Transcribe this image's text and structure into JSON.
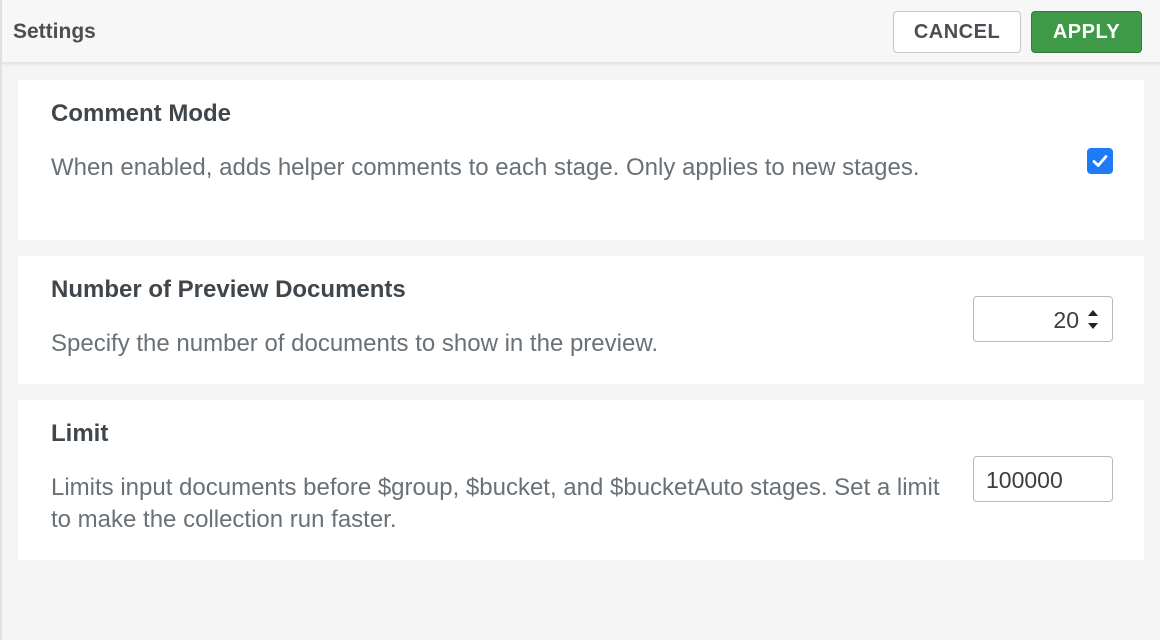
{
  "header": {
    "title": "Settings",
    "cancel_label": "CANCEL",
    "apply_label": "APPLY"
  },
  "settings": [
    {
      "title": "Comment Mode",
      "description": "When enabled, adds helper comments to each stage. Only applies to new stages.",
      "control": "checkbox",
      "checked": true
    },
    {
      "title": "Number of Preview Documents",
      "description": "Specify the number of documents to show in the preview.",
      "control": "number-stepper",
      "value": "20"
    },
    {
      "title": "Limit",
      "description": "Limits input documents before $group, $bucket, and $bucketAuto stages. Set a limit to make the collection run faster.",
      "control": "text-input",
      "value": "100000"
    }
  ],
  "icons": {
    "checkbox": "checkmark-icon",
    "stepper": "up-down-arrows-icon"
  },
  "colors": {
    "accent_blue": "#1f7af7",
    "apply_green": "#3e9a47",
    "background": "#f5f5f5",
    "card": "#ffffff"
  }
}
